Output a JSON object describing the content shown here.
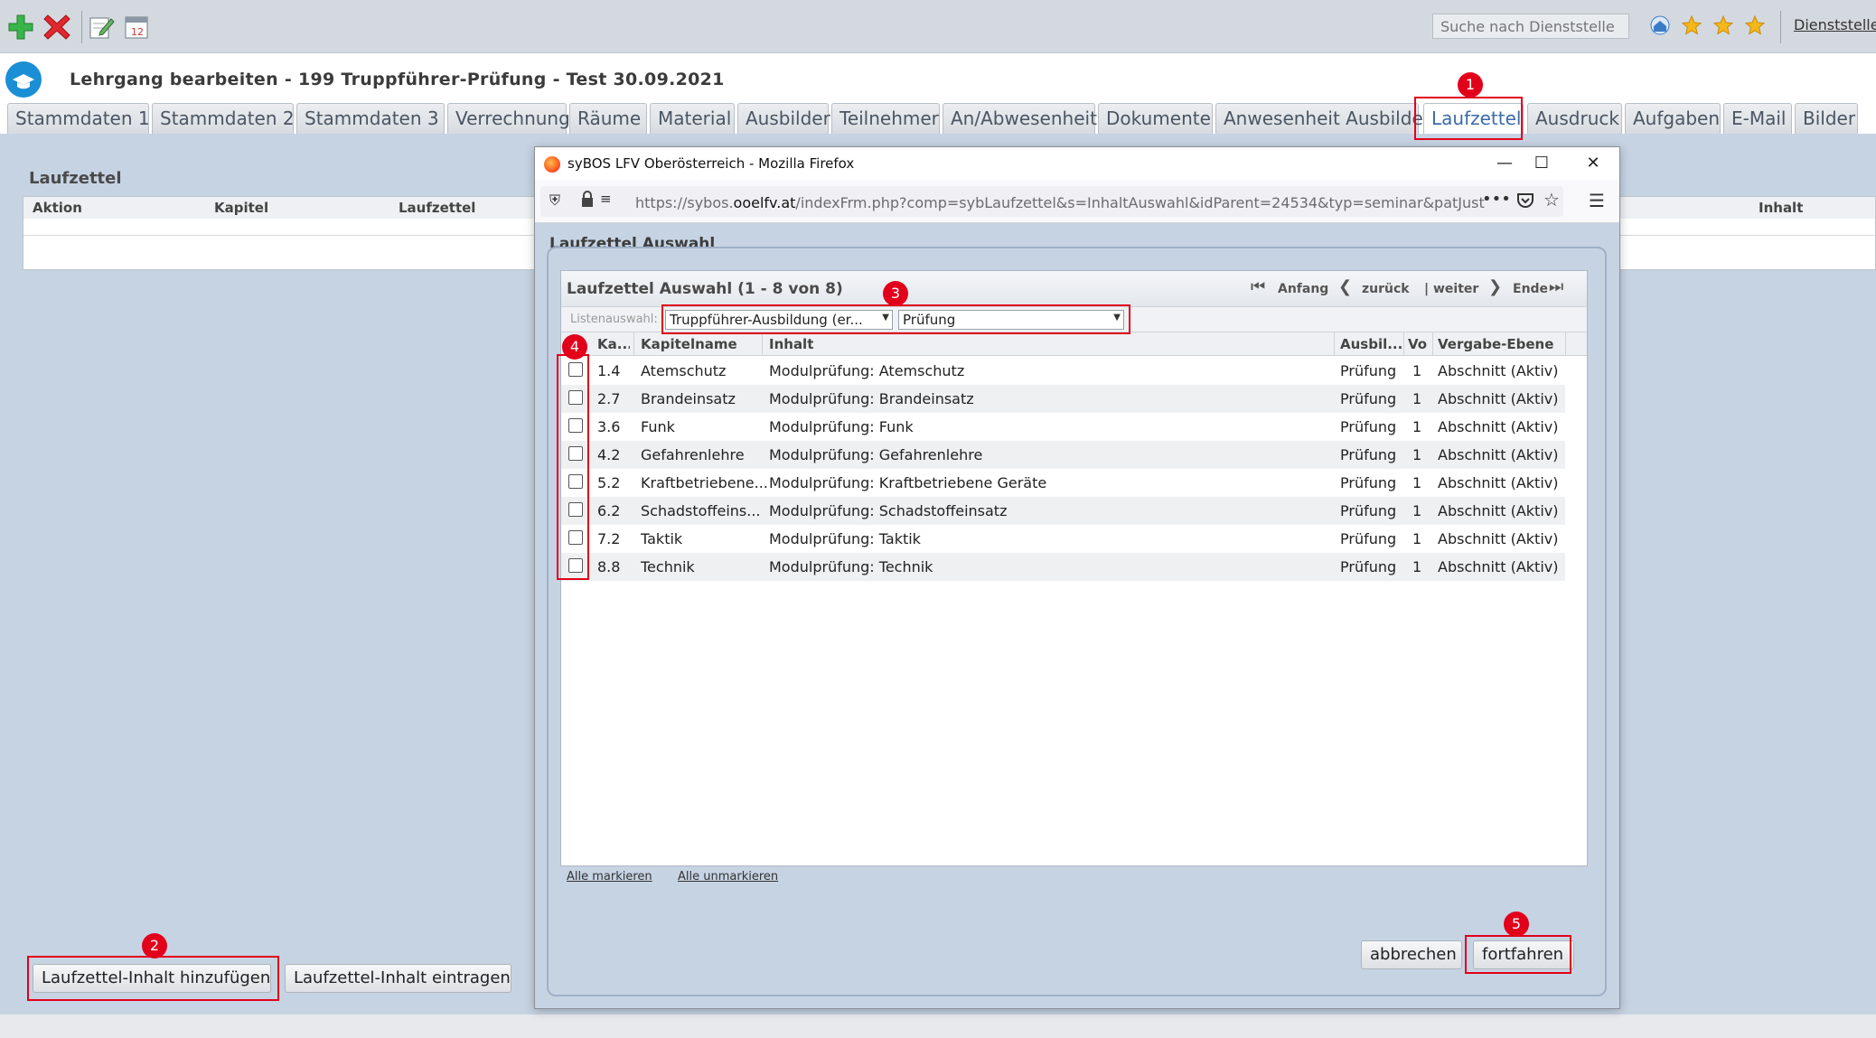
{
  "toolbar": {
    "search_placeholder": "Suche nach Dienststelle",
    "dienststelle_link": "Dienststelle",
    "icons": [
      "add-icon",
      "delete-icon",
      "edit-icon",
      "calendar-icon",
      "home-icon",
      "star-icon",
      "star-icon",
      "star-icon"
    ]
  },
  "page": {
    "title": "Lehrgang bearbeiten - 199 Truppführer-Prüfung - Test 30.09.2021"
  },
  "tabs": [
    {
      "label": "Stammdaten 1"
    },
    {
      "label": "Stammdaten 2"
    },
    {
      "label": "Stammdaten 3"
    },
    {
      "label": "Verrechnung"
    },
    {
      "label": "Räume"
    },
    {
      "label": "Material"
    },
    {
      "label": "Ausbilder"
    },
    {
      "label": "Teilnehmer"
    },
    {
      "label": "An/Abwesenheit"
    },
    {
      "label": "Dokumente"
    },
    {
      "label": "Anwesenheit Ausbilder"
    },
    {
      "label": "Laufzettel",
      "active": true
    },
    {
      "label": "Ausdruck"
    },
    {
      "label": "Aufgaben"
    },
    {
      "label": "E-Mail"
    },
    {
      "label": "Bilder"
    }
  ],
  "laufzettel_panel": {
    "title": "Laufzettel",
    "columns": [
      "Aktion",
      "Kapitel",
      "Laufzettel",
      "Inhalt"
    ],
    "buttons": {
      "add": "Laufzettel-Inhalt hinzufügen",
      "enter": "Laufzettel-Inhalt eintragen"
    }
  },
  "browser": {
    "window_title": "syBOS LFV Oberösterreich - Mozilla Firefox",
    "url_prefix": "https://sybos.",
    "url_domain": "ooelfv.at",
    "url_rest": "/indexFrm.php?comp=sybLaufzettel&s=InhaltAuswahl&idParent=24534&typ=seminar&patJustCont"
  },
  "dialog": {
    "title": "Laufzettel Auswahl",
    "grid_title": "Laufzettel Auswahl (1 - 8 von 8)",
    "pager": {
      "first": "Anfang",
      "prev": "zurück",
      "next": "| weiter",
      "last": "Ende"
    },
    "filter_label": "Listenauswahl:",
    "filter_1": "Truppführer-Ausbildung (er...",
    "filter_2": "Prüfung",
    "columns": [
      "Ka...",
      "Kapitelname",
      "Inhalt",
      "Ausbil...",
      "Vo",
      "Vergabe-Ebene"
    ],
    "rows": [
      {
        "ka": "1.4",
        "name": "Atemschutz",
        "inhalt": "Modulprüfung: Atemschutz",
        "ausbil": "Prüfung",
        "vo": "1",
        "ebene": "Abschnitt (Aktiv)"
      },
      {
        "ka": "2.7",
        "name": "Brandeinsatz",
        "inhalt": "Modulprüfung: Brandeinsatz",
        "ausbil": "Prüfung",
        "vo": "1",
        "ebene": "Abschnitt (Aktiv)"
      },
      {
        "ka": "3.6",
        "name": "Funk",
        "inhalt": "Modulprüfung: Funk",
        "ausbil": "Prüfung",
        "vo": "1",
        "ebene": "Abschnitt (Aktiv)"
      },
      {
        "ka": "4.2",
        "name": "Gefahrenlehre",
        "inhalt": "Modulprüfung: Gefahrenlehre",
        "ausbil": "Prüfung",
        "vo": "1",
        "ebene": "Abschnitt (Aktiv)"
      },
      {
        "ka": "5.2",
        "name": "Kraftbetriebene...",
        "inhalt": "Modulprüfung: Kraftbetriebene Geräte",
        "ausbil": "Prüfung",
        "vo": "1",
        "ebene": "Abschnitt (Aktiv)"
      },
      {
        "ka": "6.2",
        "name": "Schadstoffeins...",
        "inhalt": "Modulprüfung: Schadstoffeinsatz",
        "ausbil": "Prüfung",
        "vo": "1",
        "ebene": "Abschnitt (Aktiv)"
      },
      {
        "ka": "7.2",
        "name": "Taktik",
        "inhalt": "Modulprüfung: Taktik",
        "ausbil": "Prüfung",
        "vo": "1",
        "ebene": "Abschnitt (Aktiv)"
      },
      {
        "ka": "8.8",
        "name": "Technik",
        "inhalt": "Modulprüfung: Technik",
        "ausbil": "Prüfung",
        "vo": "1",
        "ebene": "Abschnitt (Aktiv)"
      }
    ],
    "links": {
      "mark_all": "Alle markieren",
      "unmark_all": "Alle unmarkieren"
    },
    "buttons": {
      "cancel": "abbrechen",
      "continue": "fortfahren"
    }
  },
  "annotations": [
    "1",
    "2",
    "3",
    "4",
    "5"
  ],
  "colors": {
    "annotation": "#e2001a",
    "content_bg": "#c6d3e3",
    "active_tab_text": "#3a6aa8"
  }
}
